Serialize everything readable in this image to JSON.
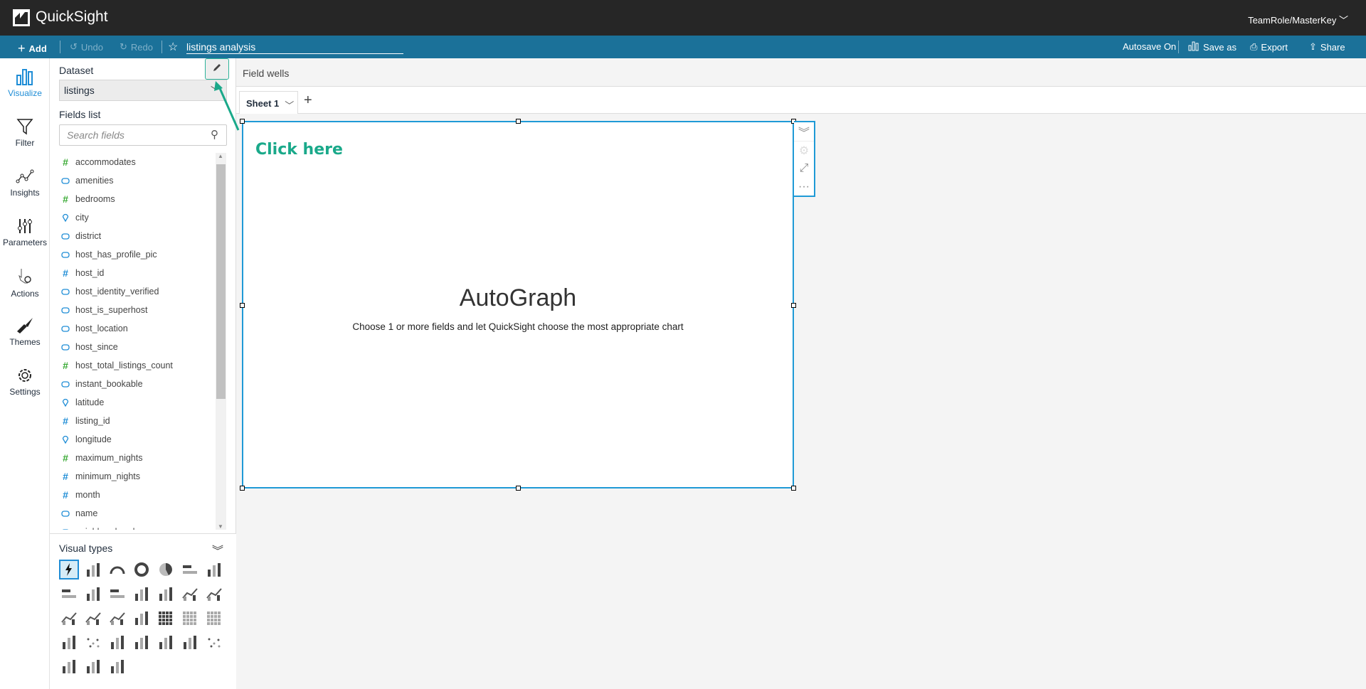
{
  "app": {
    "title": "QuickSight",
    "user": "TeamRole/MasterKey"
  },
  "toolbar": {
    "add": "Add",
    "undo": "Undo",
    "redo": "Redo",
    "analysis_name": "listings analysis",
    "autosave": "Autosave On",
    "save_as": "Save as",
    "export": "Export",
    "share": "Share"
  },
  "rail": [
    {
      "label": "Visualize",
      "icon": "bar-chart-icon"
    },
    {
      "label": "Filter",
      "icon": "filter-icon"
    },
    {
      "label": "Insights",
      "icon": "insights-icon"
    },
    {
      "label": "Parameters",
      "icon": "sliders-icon"
    },
    {
      "label": "Actions",
      "icon": "pointer-gear-icon"
    },
    {
      "label": "Themes",
      "icon": "brush-icon"
    },
    {
      "label": "Settings",
      "icon": "gear-icon"
    }
  ],
  "panel": {
    "dataset_label": "Dataset",
    "dataset": "listings",
    "fields_label": "Fields list",
    "search_placeholder": "Search fields",
    "visual_types_label": "Visual types"
  },
  "colors": {
    "measure": "#3aaa35",
    "dimension": "#1f8dd6",
    "accent": "#1f9ad6",
    "annotation": "#1aa98a"
  },
  "fields": [
    {
      "name": "accommodates",
      "type": "measure"
    },
    {
      "name": "amenities",
      "type": "string"
    },
    {
      "name": "bedrooms",
      "type": "measure"
    },
    {
      "name": "city",
      "type": "geo"
    },
    {
      "name": "district",
      "type": "string"
    },
    {
      "name": "host_has_profile_pic",
      "type": "string"
    },
    {
      "name": "host_id",
      "type": "number-dim"
    },
    {
      "name": "host_identity_verified",
      "type": "string"
    },
    {
      "name": "host_is_superhost",
      "type": "string"
    },
    {
      "name": "host_location",
      "type": "string"
    },
    {
      "name": "host_since",
      "type": "string"
    },
    {
      "name": "host_total_listings_count",
      "type": "measure"
    },
    {
      "name": "instant_bookable",
      "type": "string"
    },
    {
      "name": "latitude",
      "type": "geo"
    },
    {
      "name": "listing_id",
      "type": "number-dim"
    },
    {
      "name": "longitude",
      "type": "geo"
    },
    {
      "name": "maximum_nights",
      "type": "measure"
    },
    {
      "name": "minimum_nights",
      "type": "number-dim"
    },
    {
      "name": "month",
      "type": "number-dim"
    },
    {
      "name": "name",
      "type": "string"
    },
    {
      "name": "neighbourhood",
      "type": "string"
    }
  ],
  "visual_types": [
    "autograph-icon",
    "kpi-icon",
    "gauge-icon",
    "donut-icon",
    "pie-icon",
    "horizontal-bar-icon",
    "vertical-bar-icon",
    "clustered-hbar-icon",
    "clustered-vbar-icon",
    "stacked-hbar-icon",
    "stacked-vbar-icon",
    "waterfall-icon",
    "line-icon",
    "area-icon",
    "combo-bar-line-icon",
    "combo-stacked-line-icon",
    "stacked-area-icon",
    "box-plot-icon",
    "heatmap-icon",
    "table-icon",
    "pivot-table-icon",
    "tree-map-icon",
    "scatter-icon",
    "histogram-icon",
    "funnel-icon",
    "sankey-icon",
    "filled-map-icon",
    "points-map-icon",
    "insight-icon",
    "word-cloud-icon",
    "custom-visual-icon"
  ],
  "main": {
    "field_wells": "Field wells",
    "sheet": "Sheet 1",
    "annotation": "Click here",
    "autograph_title": "AutoGraph",
    "autograph_subtitle": "Choose 1 or more fields and let QuickSight choose the most appropriate chart"
  }
}
